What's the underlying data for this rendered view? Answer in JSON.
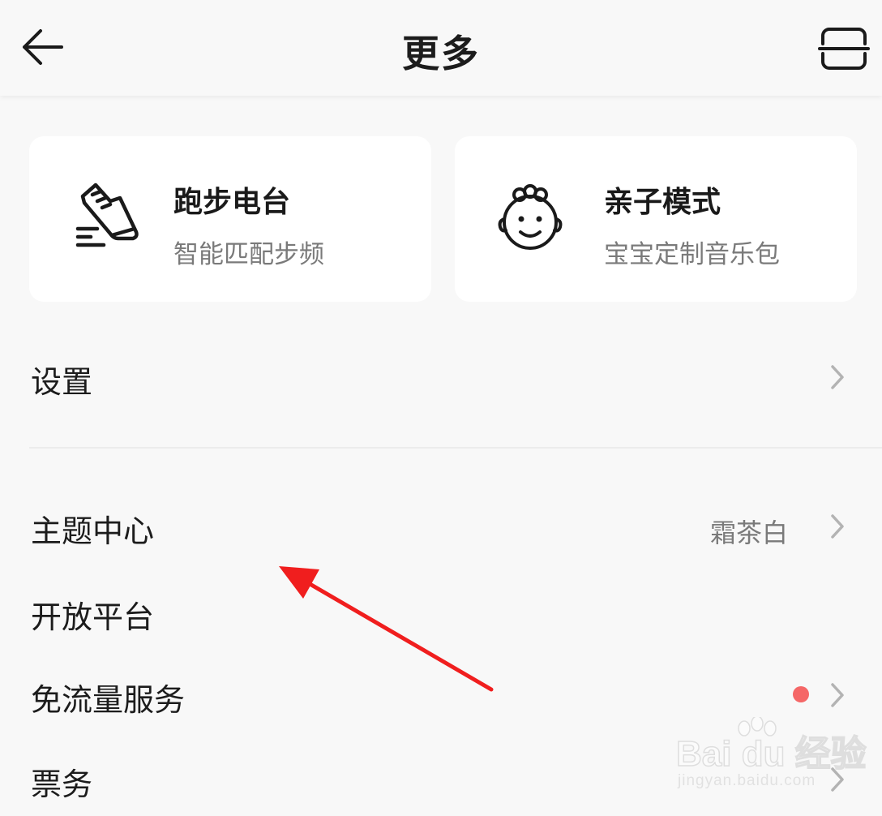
{
  "header": {
    "title": "更多",
    "back_icon": "arrow-left-icon",
    "scan_icon": "scan-icon"
  },
  "cards": [
    {
      "title": "跑步电台",
      "subtitle": "智能匹配步频",
      "icon": "running-shoe-icon"
    },
    {
      "title": "亲子模式",
      "subtitle": "宝宝定制音乐包",
      "icon": "baby-face-icon"
    }
  ],
  "menu": {
    "settings": "设置",
    "theme_center": "主题中心",
    "theme_value": "霜茶白",
    "open_platform": "开放平台",
    "free_data": "免流量服务",
    "tickets": "票务"
  },
  "watermark": {
    "logo_text": "Bai du 经验",
    "url": "jingyan.baidu.com"
  },
  "colors": {
    "background": "#f8f8f8",
    "card": "#ffffff",
    "badge_red": "#f56767",
    "annotation_arrow": "#f01e1e"
  }
}
